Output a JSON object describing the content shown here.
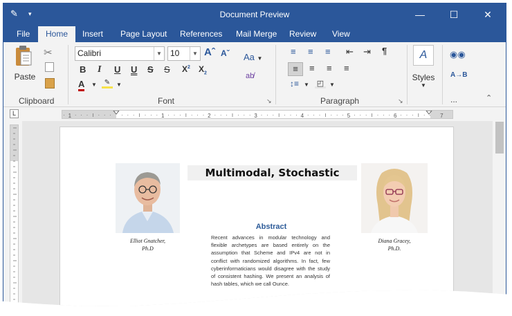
{
  "window": {
    "title": "Document Preview"
  },
  "tabs": [
    "File",
    "Home",
    "Insert",
    "Page Layout",
    "References",
    "Mail Merge",
    "Review",
    "View"
  ],
  "ribbon": {
    "clipboard": {
      "group_label": "Clipboard",
      "paste_label": "Paste"
    },
    "font": {
      "group_label": "Font",
      "font_name": "Calibri",
      "font_size": "10",
      "change_case_label": "Aa"
    },
    "paragraph": {
      "group_label": "Paragraph"
    },
    "styles": {
      "label": "Styles",
      "more_label": "..."
    }
  },
  "document": {
    "title": "Multimodal, Stochastic",
    "abstract_heading": "Abstract",
    "abstract_text": "Recent advances in modular technology and flexible archetypes are based entirely on the assumption that Scheme and IPv4 are not in conflict with randomized algorithms. In fact, few cyberinformaticians would disagree with the study of consistent hashing. We present an analysis of hash tables, which we call Ounce.",
    "author_left": {
      "name": "Elliot Gnatcher,",
      "degree": "Ph.D"
    },
    "author_right": {
      "name": "Diana Gracey,",
      "degree": "Ph.D."
    }
  },
  "ruler": {
    "numbers": [
      "1",
      "1",
      "2",
      "3",
      "4",
      "5",
      "6",
      "7"
    ]
  },
  "colors": {
    "accent": "#2b579a",
    "heading": "#2e5c99"
  }
}
